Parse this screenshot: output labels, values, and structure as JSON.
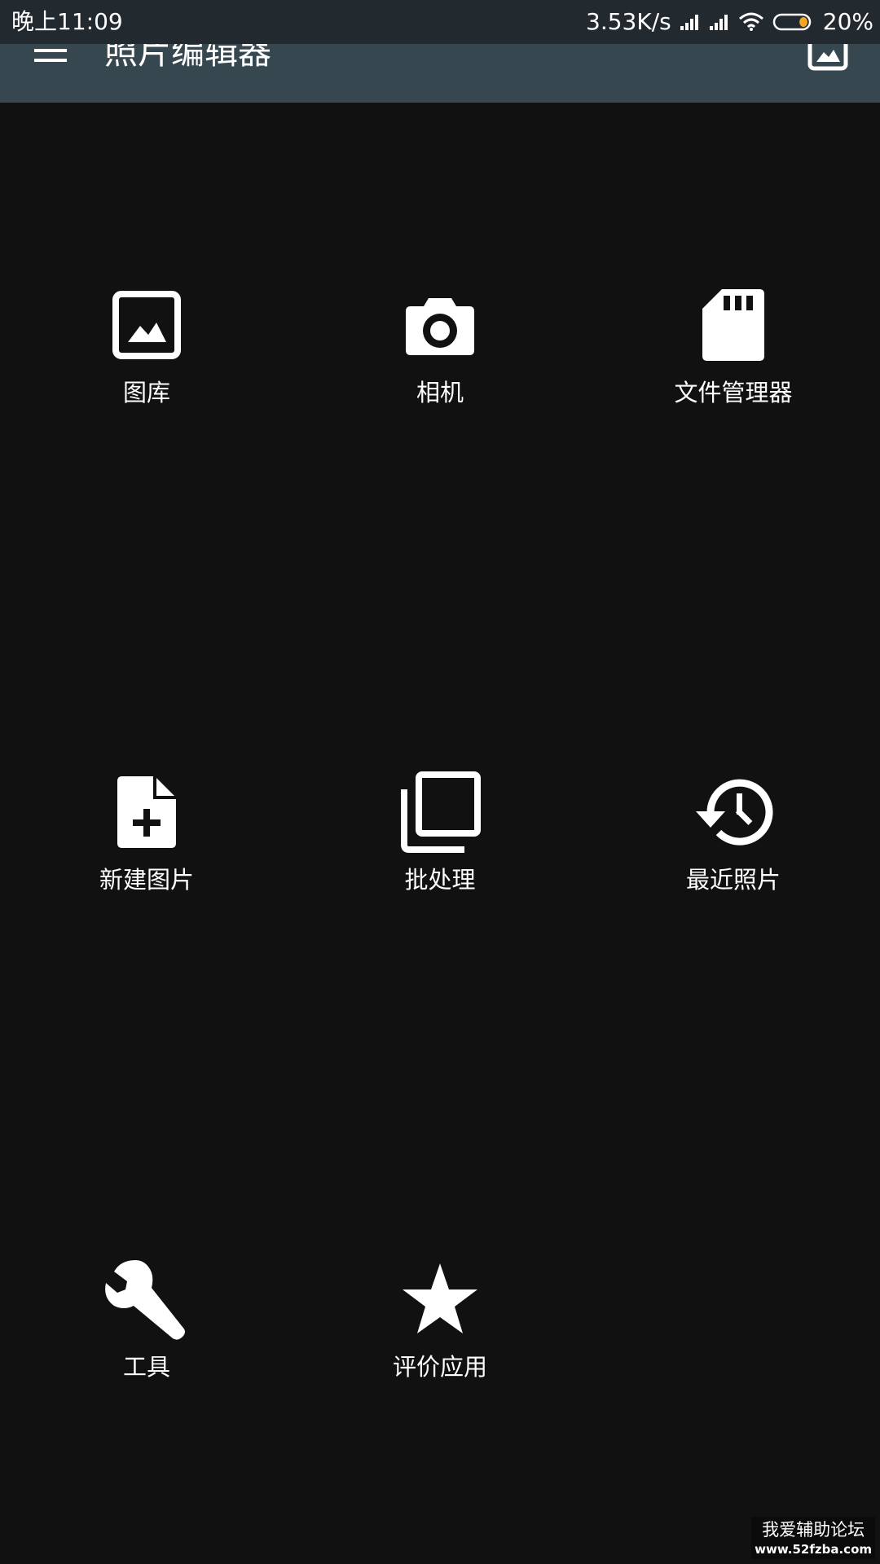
{
  "status_bar": {
    "time": "晚上11:09",
    "net_speed": "3.53K/s",
    "battery": "20%",
    "icons": [
      "signal-icon",
      "signal-icon",
      "wifi-icon",
      "battery-icon"
    ],
    "battery_level": 0.2
  },
  "app_bar": {
    "title": "照片编辑器",
    "menu_icon": "hamburger-menu-icon",
    "action_icon": "image-icon"
  },
  "grid": [
    {
      "label": "图库",
      "icon": "image-icon"
    },
    {
      "label": "相机",
      "icon": "camera-icon"
    },
    {
      "label": "文件管理器",
      "icon": "sd-card-icon"
    },
    {
      "label": "新建图片",
      "icon": "new-file-icon"
    },
    {
      "label": "批处理",
      "icon": "batch-icon"
    },
    {
      "label": "最近照片",
      "icon": "history-icon"
    },
    {
      "label": "工具",
      "icon": "wrench-icon"
    },
    {
      "label": "评价应用",
      "icon": "star-icon"
    }
  ],
  "watermark": {
    "line1": "我爱辅助论坛",
    "line2": "www.52fzba.com"
  },
  "colors": {
    "background": "#111111",
    "app_bar": "#37474f",
    "status_bar": "#232a2f",
    "icon": "#ffffff",
    "battery_accent": "#f5a623"
  }
}
